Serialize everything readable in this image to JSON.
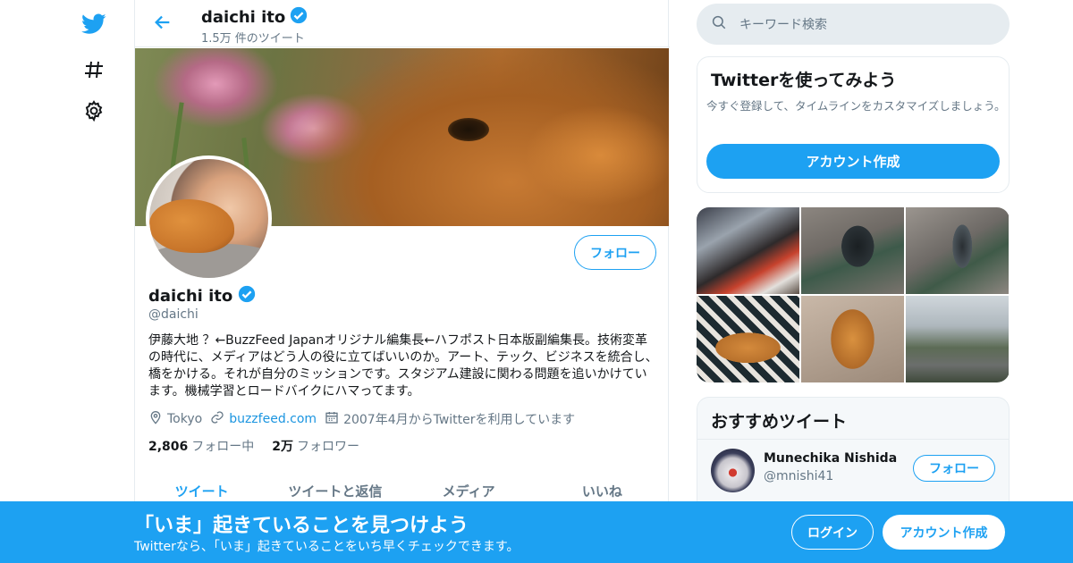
{
  "colors": {
    "accent": "#1da1f2",
    "text": "#14171a",
    "muted": "#657786",
    "border": "#e6ecf0"
  },
  "nav": {
    "icons": [
      "twitter-bird-icon",
      "hashtag-icon",
      "gear-icon"
    ]
  },
  "header": {
    "name": "daichi ito",
    "tweet_count": "1.5万 件のツイート"
  },
  "profile": {
    "name": "daichi ito",
    "handle": "@daichi",
    "follow_label": "フォロー",
    "bio": "伊藤大地 ？←BuzzFeed Japanオリジナル編集長←ハフポスト日本版副編集長。技術変革の時代に、メディアはどう人の役に立てばいいのか。アート、テック、ビジネスを統合し、橋をかける。それが自分のミッションです。スタジアム建設に関わる問題を追いかけています。機械学習とロードバイクにハマってます。",
    "location": "Tokyo",
    "website": "buzzfeed.com",
    "joined": "2007年4月からTwitterを利用しています",
    "following_count": "2,806",
    "following_label": "フォロー中",
    "followers_count": "2万",
    "followers_label": "フォロワー"
  },
  "tabs": [
    {
      "label": "ツイート",
      "active": true
    },
    {
      "label": "ツイートと返信",
      "active": false
    },
    {
      "label": "メディア",
      "active": false
    },
    {
      "label": "いいね",
      "active": false
    }
  ],
  "search": {
    "placeholder": "キーワード検索"
  },
  "signup_card": {
    "title": "Twitterを使ってみよう",
    "text": "今すぐ登録して、タイムラインをカスタマイズしましょう。",
    "button": "アカウント作成"
  },
  "recommended": {
    "title": "おすすめツイート",
    "user": {
      "name": "Munechika Nishida",
      "handle": "@mnishi41",
      "follow_label": "フォロー"
    }
  },
  "bottom_bar": {
    "title": "「いま」起きていることを見つけよう",
    "subtitle": "Twitterなら、「いま」起きていることをいち早くチェックできます。",
    "login": "ログイン",
    "signup": "アカウント作成"
  }
}
